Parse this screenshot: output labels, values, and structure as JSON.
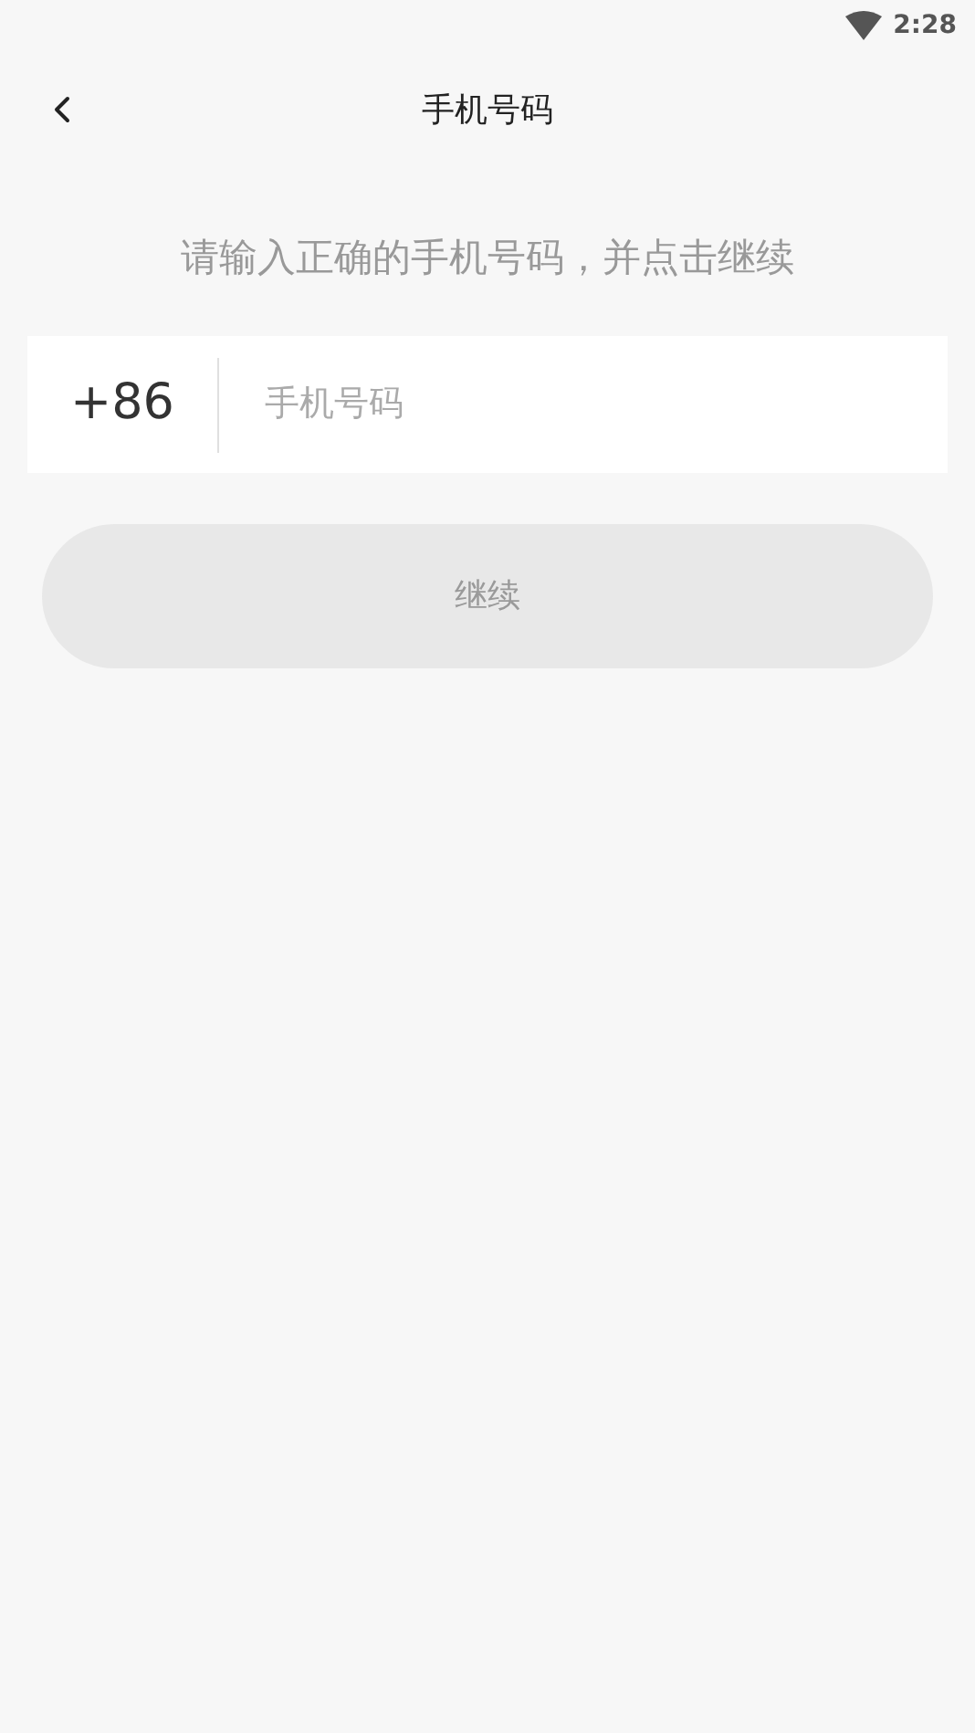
{
  "status_bar": {
    "time": "2:28"
  },
  "header": {
    "title": "手机号码"
  },
  "instruction": "请输入正确的手机号码，并点击继续",
  "phone": {
    "country_code": "+86",
    "placeholder": "手机号码"
  },
  "continue_button": {
    "label": "继续",
    "disabled": true
  }
}
